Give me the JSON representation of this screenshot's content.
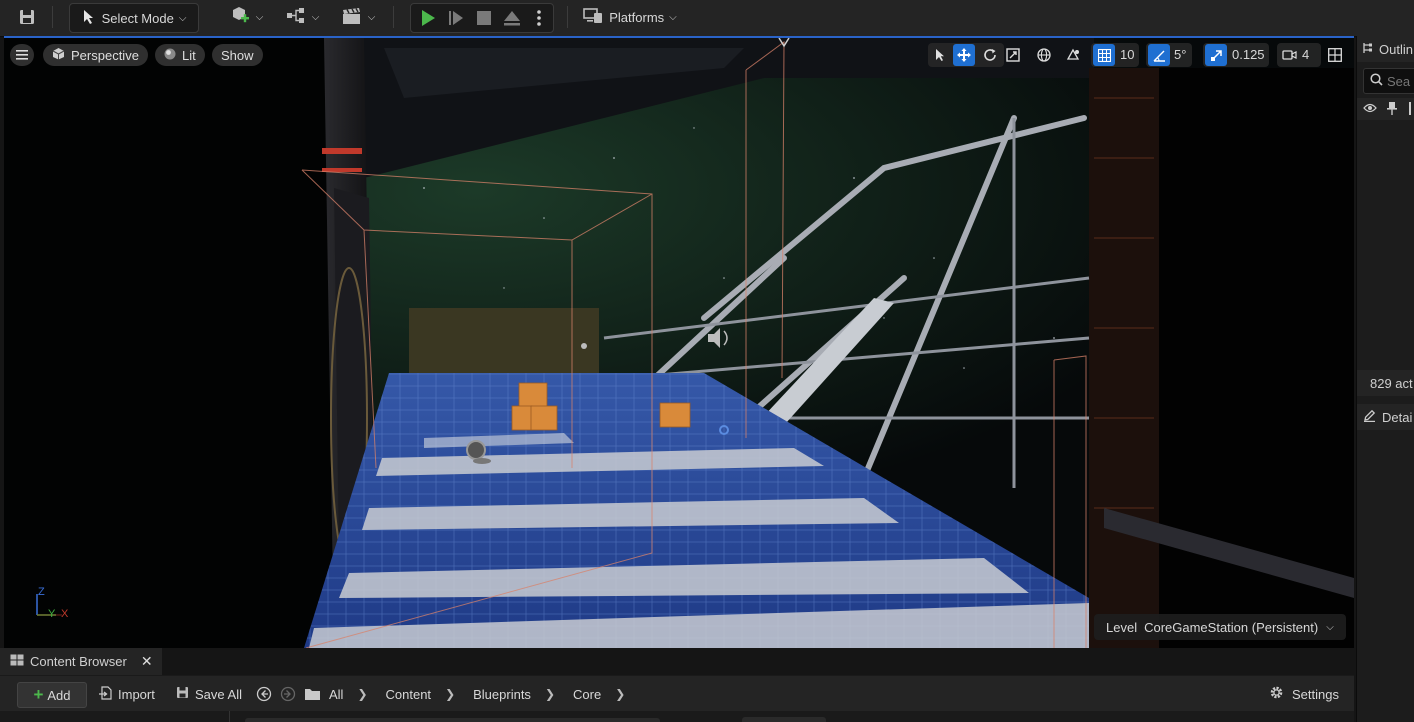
{
  "toolbar": {
    "mode_label": "Select Mode",
    "platforms_label": "Platforms"
  },
  "viewport": {
    "perspective_label": "Perspective",
    "lit_label": "Lit",
    "show_label": "Show",
    "grid_snap_value": "10",
    "rotation_snap_value": "5°",
    "scale_snap_value": "0.125",
    "camera_speed_value": "4",
    "level_prefix": "Level",
    "level_name": "CoreGameStation (Persistent)",
    "axis_z": "Z",
    "axis_y": "Y",
    "axis_x": "X"
  },
  "outliner": {
    "title": "Outlin",
    "search_placeholder": "Sea",
    "actor_count": "829 act"
  },
  "details": {
    "title": "Detai"
  },
  "content_browser": {
    "tab_label": "Content Browser",
    "add_label": "Add",
    "import_label": "Import",
    "save_all_label": "Save All",
    "breadcrumbs": [
      "All",
      "Content",
      "Blueprints",
      "Core"
    ],
    "settings_label": "Settings"
  },
  "colors": {
    "accent": "#1f6fd1",
    "play_green": "#4cb84c",
    "add_green": "#4cb84c"
  }
}
